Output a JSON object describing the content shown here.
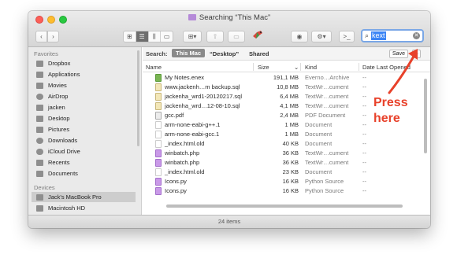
{
  "window": {
    "title": "Searching “This Mac”"
  },
  "toolbar": {
    "back_icon": "chevron-left-icon",
    "forward_icon": "chevron-right-icon",
    "view_modes": [
      "icon-view",
      "list-view",
      "column-view",
      "gallery-view"
    ],
    "active_view": "list-view",
    "search_value": "kext"
  },
  "sidebar": {
    "favorites_header": "Favorites",
    "favorites": [
      {
        "label": "Dropbox",
        "icon": "folder-icon"
      },
      {
        "label": "Applications",
        "icon": "applications-icon"
      },
      {
        "label": "Movies",
        "icon": "movies-icon"
      },
      {
        "label": "AirDrop",
        "icon": "airdrop-icon"
      },
      {
        "label": "jacken",
        "icon": "home-icon"
      },
      {
        "label": "Desktop",
        "icon": "desktop-icon"
      },
      {
        "label": "Pictures",
        "icon": "pictures-icon"
      },
      {
        "label": "Downloads",
        "icon": "downloads-icon"
      },
      {
        "label": "iCloud Drive",
        "icon": "cloud-icon"
      },
      {
        "label": "Recents",
        "icon": "recents-icon"
      },
      {
        "label": "Documents",
        "icon": "documents-icon"
      }
    ],
    "devices_header": "Devices",
    "devices": [
      {
        "label": "Jack's MacBook Pro",
        "icon": "laptop-icon",
        "selected": true
      },
      {
        "label": "Macintosh HD",
        "icon": "disk-icon",
        "selected": false
      }
    ]
  },
  "scope": {
    "label": "Search:",
    "this_mac": "This Mac",
    "desktop": "“Desktop”",
    "shared": "Shared",
    "save": "Save",
    "add": "+"
  },
  "columns": {
    "name": "Name",
    "size": "Size",
    "kind": "Kind",
    "date": "Date Last Opened"
  },
  "files": [
    {
      "name": "My Notes.enex",
      "size": "191,1 MB",
      "kind": "Everno…Archive",
      "date": "--",
      "icon": "enex"
    },
    {
      "name": "www.jackenh…m backup.sql",
      "size": "10,8 MB",
      "kind": "TextWr…cument",
      "date": "--",
      "icon": "sql"
    },
    {
      "name": "jackenha_wrd1-20120217.sql",
      "size": "6,4 MB",
      "kind": "TextWr…cument",
      "date": "--",
      "icon": "sql"
    },
    {
      "name": "jackenha_wrd…12-08-10.sql",
      "size": "4,1 MB",
      "kind": "TextWr…cument",
      "date": "--",
      "icon": "sql"
    },
    {
      "name": "gcc.pdf",
      "size": "2,4 MB",
      "kind": "PDF Document",
      "date": "--",
      "icon": "pdf"
    },
    {
      "name": "arm-none-eabi-g++.1",
      "size": "1 MB",
      "kind": "Document",
      "date": "--",
      "icon": "blank"
    },
    {
      "name": "arm-none-eabi-gcc.1",
      "size": "1 MB",
      "kind": "Document",
      "date": "--",
      "icon": "blank"
    },
    {
      "name": "_index.html.old",
      "size": "40 KB",
      "kind": "Document",
      "date": "--",
      "icon": "blank"
    },
    {
      "name": "winbatch.php",
      "size": "36 KB",
      "kind": "TextWr…cument",
      "date": "--",
      "icon": "purple"
    },
    {
      "name": "winbatch.php",
      "size": "36 KB",
      "kind": "TextWr…cument",
      "date": "--",
      "icon": "purple"
    },
    {
      "name": "_index.html.old",
      "size": "23 KB",
      "kind": "Document",
      "date": "--",
      "icon": "blank"
    },
    {
      "name": "Icons.py",
      "size": "16 KB",
      "kind": "Python Source",
      "date": "--",
      "icon": "purple"
    },
    {
      "name": "Icons.py",
      "size": "16 KB",
      "kind": "Python Source",
      "date": "--",
      "icon": "purple"
    }
  ],
  "status": {
    "items": "24 items"
  },
  "annotation": {
    "line1": "Press",
    "line2": "here",
    "color": "#e8412a"
  }
}
